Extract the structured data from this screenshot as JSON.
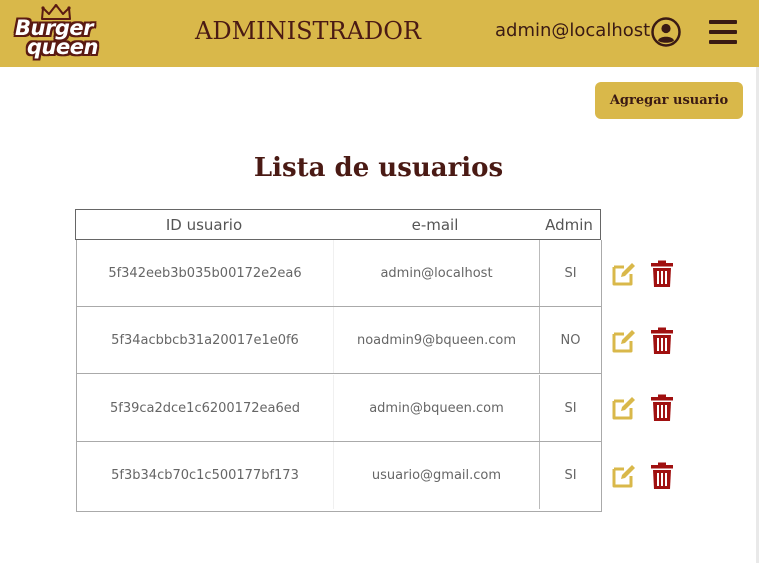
{
  "header": {
    "logo_line1": "Burger",
    "logo_line2": "queen",
    "title": "ADMINISTRADOR",
    "user_email": "admin@localhost"
  },
  "toolbar": {
    "add_user_label": "Agregar usuario"
  },
  "main": {
    "title": "Lista de usuarios",
    "columns": [
      "ID usuario",
      "e-mail",
      "Admin"
    ],
    "rows": [
      {
        "id": "5f342eeb3b035b00172e2ea6",
        "email": "admin@localhost",
        "admin": "SI"
      },
      {
        "id": "5f34acbbcb31a20017e1e0f6",
        "email": "noadmin9@bqueen.com",
        "admin": "NO"
      },
      {
        "id": "5f39ca2dce1c6200172ea6ed",
        "email": "admin@bqueen.com",
        "admin": "SI"
      },
      {
        "id": "5f3b34cb70c1c500177bf173",
        "email": "usuario@gmail.com",
        "admin": "SI"
      }
    ]
  },
  "icons": {
    "avatar": "user-circle-icon",
    "menu": "hamburger-menu-icon",
    "edit": "edit-icon",
    "delete": "trash-icon"
  },
  "colors": {
    "header_bg": "#d9b84a",
    "brand_dark": "#4a1a14",
    "edit_icon": "#d9b84a",
    "delete_icon": "#a01010"
  }
}
